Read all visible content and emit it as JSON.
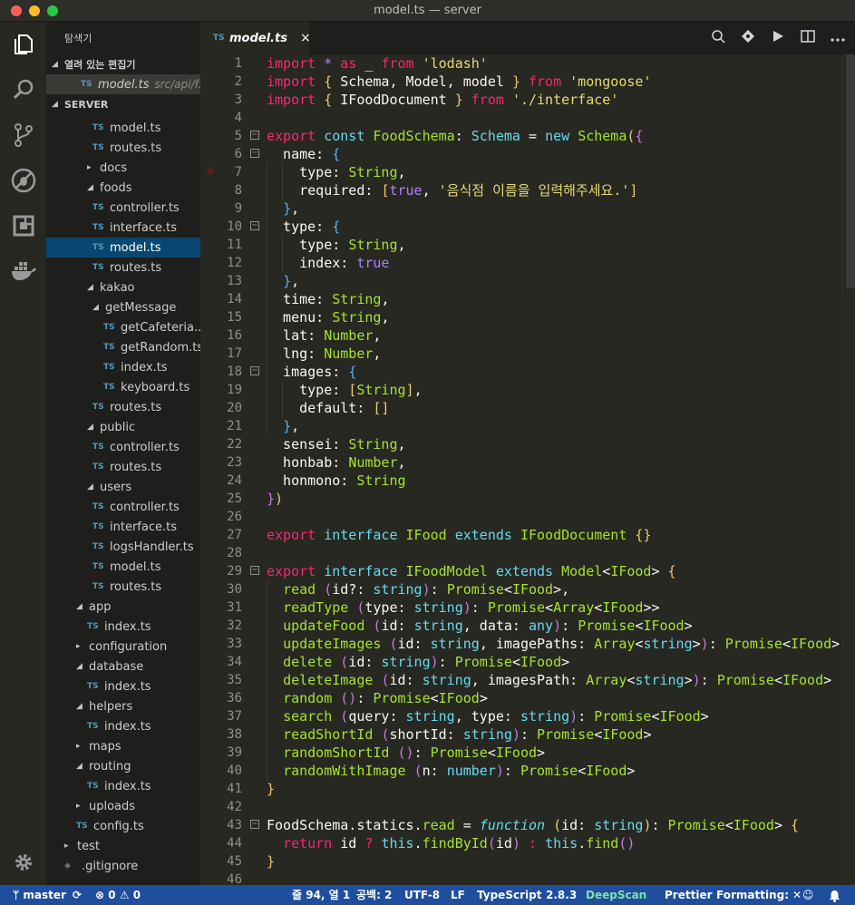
{
  "window": {
    "title": "model.ts — server"
  },
  "activity": {
    "icons": [
      "files-icon",
      "search-icon",
      "source-control-icon",
      "debug-icon",
      "extensions-icon",
      "docker-icon",
      "gear-icon"
    ]
  },
  "sidebar": {
    "header": "탐색기",
    "open_editors_label": "열려 있는 편집기",
    "open_editor": {
      "name": "model.ts",
      "path": "src/api/f..."
    },
    "project_label": "SERVER",
    "tree": [
      {
        "label": "model.ts",
        "depth": 3,
        "kind": "ts"
      },
      {
        "label": "routes.ts",
        "depth": 3,
        "kind": "ts"
      },
      {
        "label": "docs",
        "depth": 2,
        "kind": "folder-closed"
      },
      {
        "label": "foods",
        "depth": 2,
        "kind": "folder-open"
      },
      {
        "label": "controller.ts",
        "depth": 3,
        "kind": "ts"
      },
      {
        "label": "interface.ts",
        "depth": 3,
        "kind": "ts"
      },
      {
        "label": "model.ts",
        "depth": 3,
        "kind": "ts",
        "selected": true
      },
      {
        "label": "routes.ts",
        "depth": 3,
        "kind": "ts"
      },
      {
        "label": "kakao",
        "depth": 2,
        "kind": "folder-open"
      },
      {
        "label": "getMessage",
        "depth": 3,
        "kind": "folder-open"
      },
      {
        "label": "getCafeteria...",
        "depth": 4,
        "kind": "ts"
      },
      {
        "label": "getRandom.ts",
        "depth": 4,
        "kind": "ts"
      },
      {
        "label": "index.ts",
        "depth": 4,
        "kind": "ts"
      },
      {
        "label": "keyboard.ts",
        "depth": 4,
        "kind": "ts"
      },
      {
        "label": "routes.ts",
        "depth": 3,
        "kind": "ts"
      },
      {
        "label": "public",
        "depth": 2,
        "kind": "folder-open"
      },
      {
        "label": "controller.ts",
        "depth": 3,
        "kind": "ts"
      },
      {
        "label": "routes.ts",
        "depth": 3,
        "kind": "ts"
      },
      {
        "label": "users",
        "depth": 2,
        "kind": "folder-open"
      },
      {
        "label": "controller.ts",
        "depth": 3,
        "kind": "ts"
      },
      {
        "label": "interface.ts",
        "depth": 3,
        "kind": "ts"
      },
      {
        "label": "logsHandler.ts",
        "depth": 3,
        "kind": "ts"
      },
      {
        "label": "model.ts",
        "depth": 3,
        "kind": "ts"
      },
      {
        "label": "routes.ts",
        "depth": 3,
        "kind": "ts"
      },
      {
        "label": "app",
        "depth": 1,
        "kind": "folder-open"
      },
      {
        "label": "index.ts",
        "depth": 2,
        "kind": "ts"
      },
      {
        "label": "configuration",
        "depth": 1,
        "kind": "folder-closed"
      },
      {
        "label": "database",
        "depth": 1,
        "kind": "folder-open"
      },
      {
        "label": "index.ts",
        "depth": 2,
        "kind": "ts"
      },
      {
        "label": "helpers",
        "depth": 1,
        "kind": "folder-open"
      },
      {
        "label": "index.ts",
        "depth": 2,
        "kind": "ts"
      },
      {
        "label": "maps",
        "depth": 1,
        "kind": "folder-closed"
      },
      {
        "label": "routing",
        "depth": 1,
        "kind": "folder-open"
      },
      {
        "label": "index.ts",
        "depth": 2,
        "kind": "ts"
      },
      {
        "label": "uploads",
        "depth": 1,
        "kind": "folder-closed"
      },
      {
        "label": "config.ts",
        "depth": 1,
        "kind": "ts"
      },
      {
        "label": "test",
        "depth": 0,
        "kind": "folder-closed"
      },
      {
        "label": ".gitignore",
        "depth": 0,
        "kind": "gitignore"
      }
    ]
  },
  "tabs": {
    "active": {
      "label": "model.ts",
      "lang_badge": "TS",
      "close": "×"
    }
  },
  "editor": {
    "lines": [
      [
        [
          "k",
          "import "
        ],
        [
          "o",
          "* "
        ],
        [
          "k",
          "as "
        ],
        [
          "ws",
          "_ "
        ],
        [
          "k",
          "from "
        ],
        [
          "s",
          "'lodash'"
        ]
      ],
      [
        [
          "k",
          "import "
        ],
        [
          "br1",
          "{ "
        ],
        [
          "ws",
          "Schema, Model, model "
        ],
        [
          "br1",
          "} "
        ],
        [
          "k",
          "from "
        ],
        [
          "s",
          "'mongoose'"
        ]
      ],
      [
        [
          "k",
          "import "
        ],
        [
          "br1",
          "{ "
        ],
        [
          "ws",
          "IFoodDocument "
        ],
        [
          "br1",
          "} "
        ],
        [
          "k",
          "from "
        ],
        [
          "s",
          "'./interface'"
        ]
      ],
      [],
      [
        [
          "k",
          "export "
        ],
        [
          "kb",
          "const "
        ],
        [
          "g",
          "FoodSchema"
        ],
        [
          "ws",
          ": "
        ],
        [
          "t",
          "Schema"
        ],
        [
          "ws",
          " = "
        ],
        [
          "kb",
          "new "
        ],
        [
          "g",
          "Schema"
        ],
        [
          "br1",
          "("
        ],
        [
          "br2",
          "{"
        ]
      ],
      [
        [
          "ws",
          "  name: "
        ],
        [
          "br3",
          "{"
        ]
      ],
      [
        [
          "ws",
          "    type: "
        ],
        [
          "g",
          "String"
        ],
        [
          "ws",
          ","
        ]
      ],
      [
        [
          "ws",
          "    required: "
        ],
        [
          "br1",
          "["
        ],
        [
          "o",
          "true"
        ],
        [
          "ws",
          ", "
        ],
        [
          "s",
          "'음식점 이름을 입력해주세요.'"
        ],
        [
          "br1",
          "]"
        ]
      ],
      [
        [
          "ws",
          "  "
        ],
        [
          "br3",
          "}"
        ],
        [
          "ws",
          ","
        ]
      ],
      [
        [
          "ws",
          "  type: "
        ],
        [
          "br3",
          "{"
        ]
      ],
      [
        [
          "ws",
          "    type: "
        ],
        [
          "g",
          "String"
        ],
        [
          "ws",
          ","
        ]
      ],
      [
        [
          "ws",
          "    index: "
        ],
        [
          "o",
          "true"
        ]
      ],
      [
        [
          "ws",
          "  "
        ],
        [
          "br3",
          "}"
        ],
        [
          "ws",
          ","
        ]
      ],
      [
        [
          "ws",
          "  time: "
        ],
        [
          "g",
          "String"
        ],
        [
          "ws",
          ","
        ]
      ],
      [
        [
          "ws",
          "  menu: "
        ],
        [
          "g",
          "String"
        ],
        [
          "ws",
          ","
        ]
      ],
      [
        [
          "ws",
          "  lat: "
        ],
        [
          "g",
          "Number"
        ],
        [
          "ws",
          ","
        ]
      ],
      [
        [
          "ws",
          "  lng: "
        ],
        [
          "g",
          "Number"
        ],
        [
          "ws",
          ","
        ]
      ],
      [
        [
          "ws",
          "  images: "
        ],
        [
          "br3",
          "{"
        ]
      ],
      [
        [
          "ws",
          "    type: "
        ],
        [
          "br1",
          "["
        ],
        [
          "g",
          "String"
        ],
        [
          "br1",
          "]"
        ],
        [
          "ws",
          ","
        ]
      ],
      [
        [
          "ws",
          "    default: "
        ],
        [
          "br1",
          "[]"
        ]
      ],
      [
        [
          "ws",
          "  "
        ],
        [
          "br3",
          "}"
        ],
        [
          "ws",
          ","
        ]
      ],
      [
        [
          "ws",
          "  sensei: "
        ],
        [
          "g",
          "String"
        ],
        [
          "ws",
          ","
        ]
      ],
      [
        [
          "ws",
          "  honbab: "
        ],
        [
          "g",
          "Number"
        ],
        [
          "ws",
          ","
        ]
      ],
      [
        [
          "ws",
          "  honmono: "
        ],
        [
          "g",
          "String"
        ]
      ],
      [
        [
          "br2",
          "}"
        ],
        [
          "br1",
          ")"
        ]
      ],
      [],
      [
        [
          "k",
          "export "
        ],
        [
          "kb",
          "interface "
        ],
        [
          "g",
          "IFood "
        ],
        [
          "kb",
          "extends "
        ],
        [
          "g",
          "IFoodDocument "
        ],
        [
          "br1",
          "{}"
        ]
      ],
      [],
      [
        [
          "k",
          "export "
        ],
        [
          "kb",
          "interface "
        ],
        [
          "g",
          "IFoodModel "
        ],
        [
          "kb",
          "extends "
        ],
        [
          "g",
          "Model"
        ],
        [
          "ws",
          "<"
        ],
        [
          "g",
          "IFood"
        ],
        [
          "ws",
          "> "
        ],
        [
          "br1",
          "{"
        ]
      ],
      [
        [
          "ws",
          "  "
        ],
        [
          "g",
          "read "
        ],
        [
          "br2",
          "("
        ],
        [
          "ws",
          "id?: "
        ],
        [
          "t",
          "string"
        ],
        [
          "br2",
          ")"
        ],
        [
          "ws",
          ": "
        ],
        [
          "g",
          "Promise"
        ],
        [
          "ws",
          "<"
        ],
        [
          "g",
          "IFood"
        ],
        [
          "ws",
          ">,"
        ]
      ],
      [
        [
          "ws",
          "  "
        ],
        [
          "g",
          "readType "
        ],
        [
          "br2",
          "("
        ],
        [
          "ws",
          "type: "
        ],
        [
          "t",
          "string"
        ],
        [
          "br2",
          ")"
        ],
        [
          "ws",
          ": "
        ],
        [
          "g",
          "Promise"
        ],
        [
          "ws",
          "<"
        ],
        [
          "g",
          "Array"
        ],
        [
          "ws",
          "<"
        ],
        [
          "g",
          "IFood"
        ],
        [
          "ws",
          ">>"
        ]
      ],
      [
        [
          "ws",
          "  "
        ],
        [
          "g",
          "updateFood "
        ],
        [
          "br2",
          "("
        ],
        [
          "ws",
          "id: "
        ],
        [
          "t",
          "string"
        ],
        [
          "ws",
          ", data: "
        ],
        [
          "t",
          "any"
        ],
        [
          "br2",
          ")"
        ],
        [
          "ws",
          ": "
        ],
        [
          "g",
          "Promise"
        ],
        [
          "ws",
          "<"
        ],
        [
          "g",
          "IFood"
        ],
        [
          "ws",
          ">"
        ]
      ],
      [
        [
          "ws",
          "  "
        ],
        [
          "g",
          "updateImages "
        ],
        [
          "br2",
          "("
        ],
        [
          "ws",
          "id: "
        ],
        [
          "t",
          "string"
        ],
        [
          "ws",
          ", imagePaths: "
        ],
        [
          "g",
          "Array"
        ],
        [
          "ws",
          "<"
        ],
        [
          "t",
          "string"
        ],
        [
          "ws",
          ">"
        ],
        [
          "br2",
          ")"
        ],
        [
          "ws",
          ": "
        ],
        [
          "g",
          "Promise"
        ],
        [
          "ws",
          "<"
        ],
        [
          "g",
          "IFood"
        ],
        [
          "ws",
          ">"
        ]
      ],
      [
        [
          "ws",
          "  "
        ],
        [
          "g",
          "delete "
        ],
        [
          "br2",
          "("
        ],
        [
          "ws",
          "id: "
        ],
        [
          "t",
          "string"
        ],
        [
          "br2",
          ")"
        ],
        [
          "ws",
          ": "
        ],
        [
          "g",
          "Promise"
        ],
        [
          "ws",
          "<"
        ],
        [
          "g",
          "IFood"
        ],
        [
          "ws",
          ">"
        ]
      ],
      [
        [
          "ws",
          "  "
        ],
        [
          "g",
          "deleteImage "
        ],
        [
          "br2",
          "("
        ],
        [
          "ws",
          "id: "
        ],
        [
          "t",
          "string"
        ],
        [
          "ws",
          ", imagesPath: "
        ],
        [
          "g",
          "Array"
        ],
        [
          "ws",
          "<"
        ],
        [
          "t",
          "string"
        ],
        [
          "ws",
          ">"
        ],
        [
          "br2",
          ")"
        ],
        [
          "ws",
          ": "
        ],
        [
          "g",
          "Promise"
        ],
        [
          "ws",
          "<"
        ],
        [
          "g",
          "IFood"
        ],
        [
          "ws",
          ">"
        ]
      ],
      [
        [
          "ws",
          "  "
        ],
        [
          "g",
          "random "
        ],
        [
          "br2",
          "()"
        ],
        [
          "ws",
          ": "
        ],
        [
          "g",
          "Promise"
        ],
        [
          "ws",
          "<"
        ],
        [
          "g",
          "IFood"
        ],
        [
          "ws",
          ">"
        ]
      ],
      [
        [
          "ws",
          "  "
        ],
        [
          "g",
          "search "
        ],
        [
          "br2",
          "("
        ],
        [
          "ws",
          "query: "
        ],
        [
          "t",
          "string"
        ],
        [
          "ws",
          ", type: "
        ],
        [
          "t",
          "string"
        ],
        [
          "br2",
          ")"
        ],
        [
          "ws",
          ": "
        ],
        [
          "g",
          "Promise"
        ],
        [
          "ws",
          "<"
        ],
        [
          "g",
          "IFood"
        ],
        [
          "ws",
          ">"
        ]
      ],
      [
        [
          "ws",
          "  "
        ],
        [
          "g",
          "readShortId "
        ],
        [
          "br2",
          "("
        ],
        [
          "ws",
          "shortId: "
        ],
        [
          "t",
          "string"
        ],
        [
          "br2",
          ")"
        ],
        [
          "ws",
          ": "
        ],
        [
          "g",
          "Promise"
        ],
        [
          "ws",
          "<"
        ],
        [
          "g",
          "IFood"
        ],
        [
          "ws",
          ">"
        ]
      ],
      [
        [
          "ws",
          "  "
        ],
        [
          "g",
          "randomShortId "
        ],
        [
          "br2",
          "()"
        ],
        [
          "ws",
          ": "
        ],
        [
          "g",
          "Promise"
        ],
        [
          "ws",
          "<"
        ],
        [
          "g",
          "IFood"
        ],
        [
          "ws",
          ">"
        ]
      ],
      [
        [
          "ws",
          "  "
        ],
        [
          "g",
          "randomWithImage "
        ],
        [
          "br2",
          "("
        ],
        [
          "ws",
          "n: "
        ],
        [
          "t",
          "number"
        ],
        [
          "br2",
          ")"
        ],
        [
          "ws",
          ": "
        ],
        [
          "g",
          "Promise"
        ],
        [
          "ws",
          "<"
        ],
        [
          "g",
          "IFood"
        ],
        [
          "ws",
          ">"
        ]
      ],
      [
        [
          "br1",
          "}"
        ]
      ],
      [],
      [
        [
          "ws",
          "FoodSchema.statics."
        ],
        [
          "g",
          "read"
        ],
        [
          "ws",
          " = "
        ],
        [
          "kbi",
          "function "
        ],
        [
          "br1",
          "("
        ],
        [
          "ws",
          "id: "
        ],
        [
          "t",
          "string"
        ],
        [
          "br1",
          ")"
        ],
        [
          "ws",
          ": "
        ],
        [
          "g",
          "Promise"
        ],
        [
          "ws",
          "<"
        ],
        [
          "g",
          "IFood"
        ],
        [
          "ws",
          "> "
        ],
        [
          "br1",
          "{"
        ]
      ],
      [
        [
          "ws",
          "  "
        ],
        [
          "k",
          "return "
        ],
        [
          "ws",
          "id "
        ],
        [
          "k",
          "? "
        ],
        [
          "kb",
          "this"
        ],
        [
          "ws",
          "."
        ],
        [
          "g",
          "findById"
        ],
        [
          "br2",
          "("
        ],
        [
          "ws",
          "id"
        ],
        [
          "br2",
          ")"
        ],
        [
          "k",
          " : "
        ],
        [
          "kb",
          "this"
        ],
        [
          "ws",
          "."
        ],
        [
          "g",
          "find"
        ],
        [
          "br2",
          "()"
        ]
      ],
      [
        [
          "br1",
          "}"
        ]
      ],
      []
    ],
    "folds": [
      5,
      6,
      10,
      18,
      29,
      43
    ],
    "breakpoint_line": 7
  },
  "status": {
    "branch": "master",
    "errors": "0",
    "warnings": "0",
    "position": "줄 94, 열 1",
    "spaces": "공백: 2",
    "encoding": "UTF-8",
    "eol": "LF",
    "language": "TypeScript",
    "ts_version": "2.8.3",
    "deepscan": "DeepScan",
    "prettier": "Prettier",
    "formatting": "Formatting: ✕"
  },
  "colors": {
    "statusbar": "#1f4e9e",
    "editor_bg": "#272822",
    "selection": "#094771",
    "deepscan": "#7fe3a0"
  }
}
